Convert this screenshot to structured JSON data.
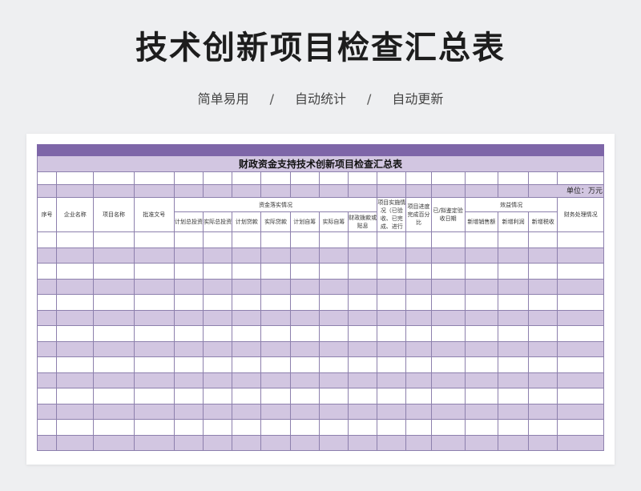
{
  "page": {
    "title": "技术创新项目检查汇总表",
    "tags": [
      "简单易用",
      "自动统计",
      "自动更新"
    ],
    "separator": "/"
  },
  "sheet": {
    "title": "财政资金支持技术创新项目检查汇总表",
    "unit": "单位：万元",
    "headers": {
      "seq": "序号",
      "company": "企业名称",
      "project": "项目名称",
      "doc_no": "批准文号",
      "funds_group": "资金落实情况",
      "planned_invest": "计划总投资",
      "actual_invest": "实际总投资",
      "planned_loan": "计划贷款",
      "actual_loan": "实际贷款",
      "planned_self": "计划自筹",
      "actual_self": "实际自筹",
      "subsidy": "财政拨款或贴息",
      "implementation": "项目实施情况（已验收、已完成、进行中）",
      "progress": "项目进度完成百分比",
      "acceptance_date": "已/拟鉴定验收日期",
      "benefit_group": "效益情况",
      "new_sales": "新增销售额",
      "new_profit": "新增利润",
      "new_tax": "新增税收",
      "finance": "财务处理情况"
    },
    "data_row_count": 14
  },
  "colors": {
    "background": "#eeeff1",
    "accent_bar": "#7e66a8",
    "band": "#d2c6e1",
    "grid": "#8d80ad"
  }
}
